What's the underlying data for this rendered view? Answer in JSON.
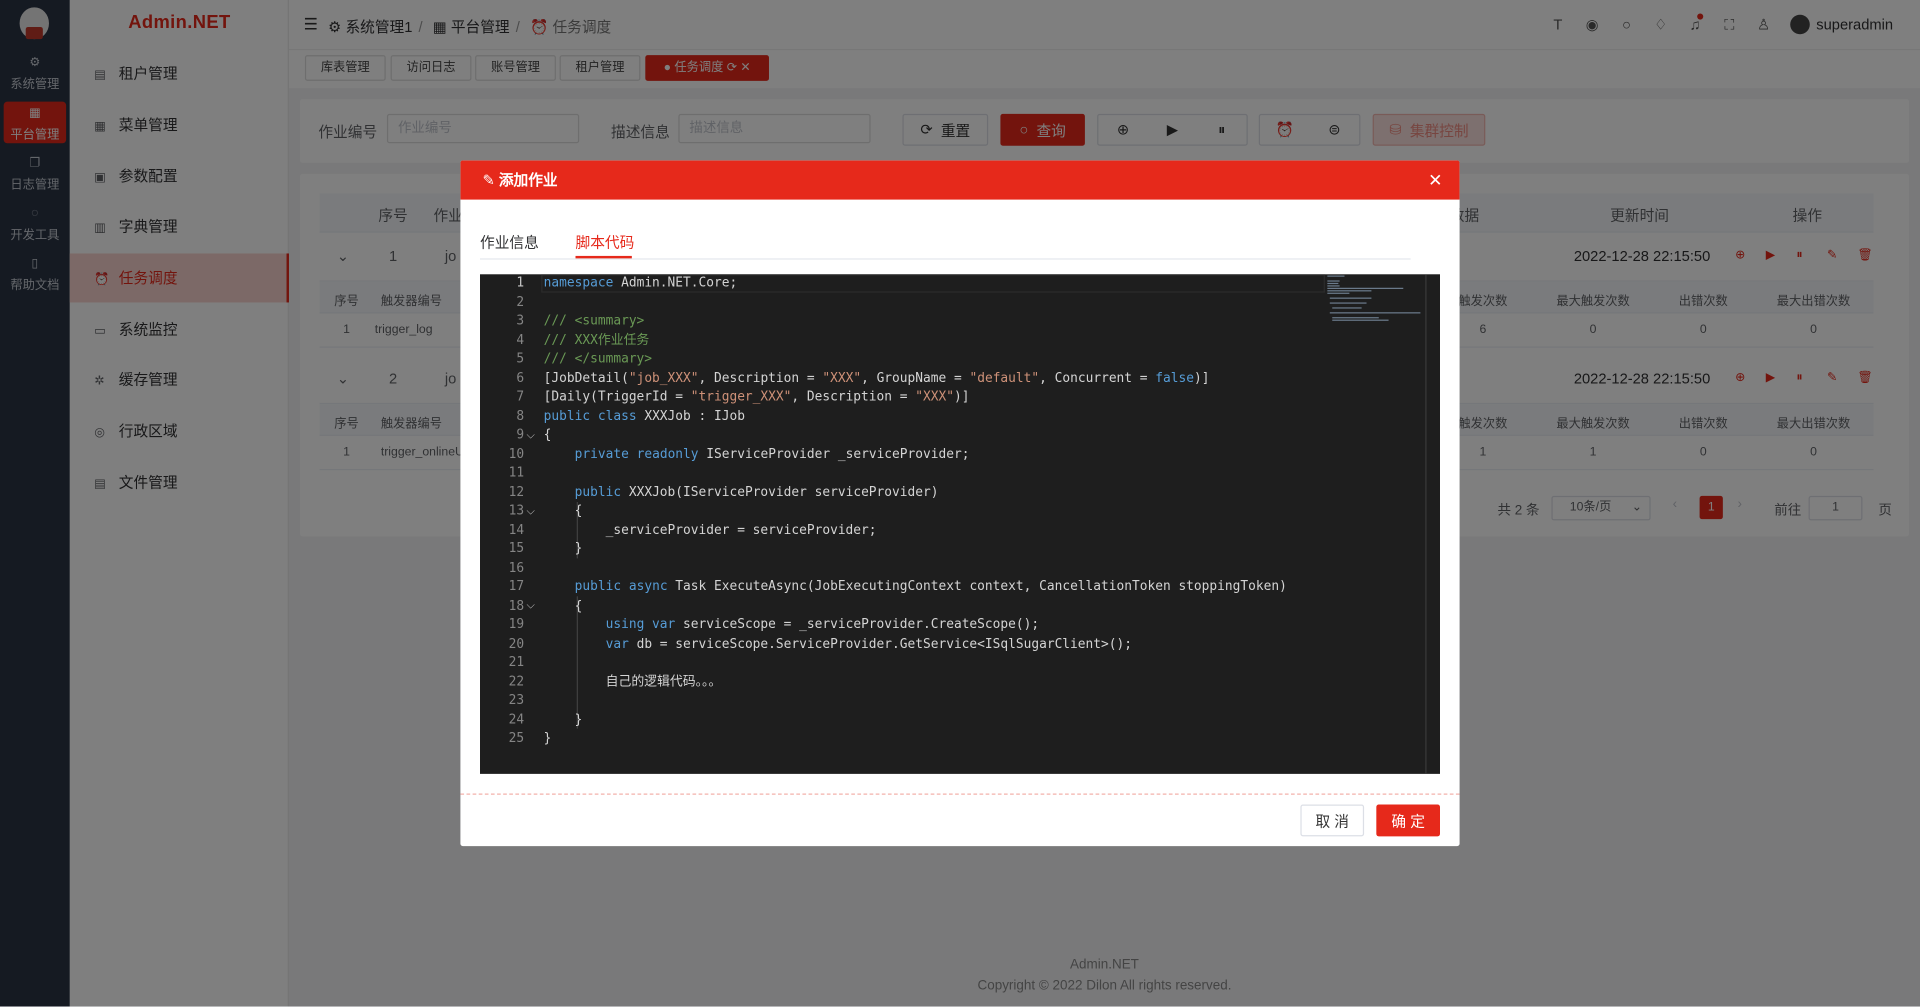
{
  "app": {
    "brand": "Admin.NET",
    "user": "superadmin"
  },
  "rail": [
    {
      "label": "系统管理",
      "icon": "gear-icon",
      "active": false
    },
    {
      "label": "平台管理",
      "icon": "grid-icon",
      "active": true
    },
    {
      "label": "日志管理",
      "icon": "log-icon",
      "active": false
    },
    {
      "label": "开发工具",
      "icon": "tool-icon",
      "active": false
    },
    {
      "label": "帮助文档",
      "icon": "doc-icon",
      "active": false
    }
  ],
  "menu": [
    {
      "label": "租户管理",
      "icon": "tenant-icon",
      "active": false
    },
    {
      "label": "菜单管理",
      "icon": "menu-icon",
      "active": false
    },
    {
      "label": "参数配置",
      "icon": "config-icon",
      "active": false
    },
    {
      "label": "字典管理",
      "icon": "dict-icon",
      "active": false
    },
    {
      "label": "任务调度",
      "icon": "alarm-icon",
      "active": true
    },
    {
      "label": "系统监控",
      "icon": "monitor-icon",
      "active": false
    },
    {
      "label": "缓存管理",
      "icon": "cache-icon",
      "active": false
    },
    {
      "label": "行政区域",
      "icon": "location-icon",
      "active": false
    },
    {
      "label": "文件管理",
      "icon": "file-icon",
      "active": false
    }
  ],
  "breadcrumb": [
    "系统管理1",
    "平台管理",
    "任务调度"
  ],
  "tags": [
    "库表管理",
    "访问日志",
    "账号管理",
    "租户管理",
    "任务调度"
  ],
  "search": {
    "job_id_label": "作业编号",
    "job_id_placeholder": "作业编号",
    "desc_label": "描述信息",
    "desc_placeholder": "描述信息",
    "reset": "重置",
    "query": "查询",
    "cluster": "集群控制"
  },
  "table": {
    "headers": [
      "序号",
      "作业",
      "数据",
      "更新时间",
      "操作"
    ],
    "jobs": [
      {
        "index": "1",
        "id_part": "jo",
        "updated": "2022-12-28 22:15:50",
        "trigger": {
          "index": "1",
          "id": "trigger_log",
          "fire_count": "6",
          "max_fire": "0",
          "error_count": "0",
          "max_error": "0"
        }
      },
      {
        "index": "2",
        "id_part": "jo",
        "updated": "2022-12-28 22:15:50",
        "trigger": {
          "index": "1",
          "id": "trigger_onlineU",
          "fire_count": "1",
          "max_fire": "1",
          "error_count": "0",
          "max_error": "0"
        }
      }
    ],
    "sub_headers": [
      "序号",
      "触发器编号",
      "触发次数",
      "最大触发次数",
      "出错次数",
      "最大出错次数"
    ]
  },
  "pagination": {
    "total": "共 2 条",
    "page_size": "10条/页",
    "current": "1",
    "goto_label": "前往",
    "goto_value": "1",
    "page_suffix": "页"
  },
  "footer": {
    "line1": "Admin.NET",
    "line2": "Copyright © 2022 Dilon All rights reserved."
  },
  "dialog": {
    "title": "添加作业",
    "tabs": [
      "作业信息",
      "脚本代码"
    ],
    "active_tab": "脚本代码",
    "cancel": "取 消",
    "confirm": "确 定",
    "code_lines": [
      "namespace Admin.NET.Core;",
      "",
      "/// <summary>",
      "/// XXX作业任务",
      "/// </summary>",
      "[JobDetail(\"job_XXX\", Description = \"XXX\", GroupName = \"default\", Concurrent = false)]",
      "[Daily(TriggerId = \"trigger_XXX\", Description = \"XXX\")]",
      "public class XXXJob : IJob",
      "{",
      "    private readonly IServiceProvider _serviceProvider;",
      "",
      "    public XXXJob(IServiceProvider serviceProvider)",
      "    {",
      "        _serviceProvider = serviceProvider;",
      "    }",
      "",
      "    public async Task ExecuteAsync(JobExecutingContext context, CancellationToken stoppingToken)",
      "    {",
      "        using var serviceScope = _serviceProvider.CreateScope();",
      "        var db = serviceScope.ServiceProvider.GetService<ISqlSugarClient>();",
      "",
      "        自己的逻辑代码。。。",
      "",
      "    }",
      "}"
    ]
  },
  "colors": {
    "primary": "#e6291b",
    "rail_bg": "#2b3445",
    "editor_bg": "#1e1e1e"
  }
}
